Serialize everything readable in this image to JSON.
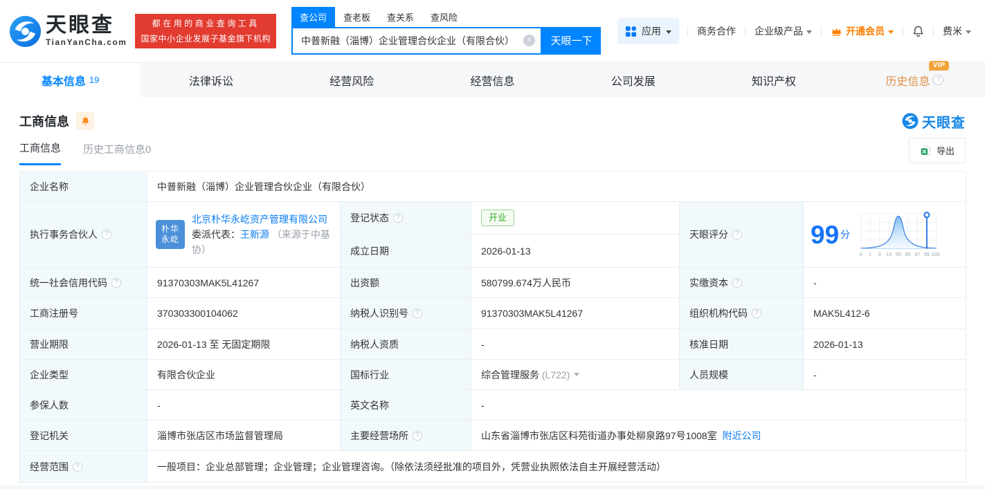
{
  "icons": {
    "help": "?",
    "clear": "×"
  },
  "header": {
    "brand": {
      "name": "天眼查",
      "domain": "TianYanCha.com"
    },
    "slogan_line1": "都在用的商业查询工具",
    "slogan_line2": "国家中小企业发展子基金旗下机构",
    "search": {
      "tabs": [
        {
          "label": "查公司"
        },
        {
          "label": "查老板"
        },
        {
          "label": "查关系"
        },
        {
          "label": "查风险"
        }
      ],
      "value": "中普新融（淄博）企业管理合伙企业（有限合伙）",
      "button": "天眼一下"
    },
    "nav": {
      "apps": "应用",
      "cooperation": "商务合作",
      "enterprise": "企业级产品",
      "membership": "开通会员",
      "username": "费米"
    }
  },
  "top_tabs": {
    "items": [
      {
        "label": "基本信息",
        "count": "19"
      },
      {
        "label": "法律诉讼"
      },
      {
        "label": "经营风险"
      },
      {
        "label": "经营信息"
      },
      {
        "label": "公司发展"
      },
      {
        "label": "知识产权"
      },
      {
        "label": "历史信息",
        "vip": "VIP"
      }
    ]
  },
  "section": {
    "title": "工商信息",
    "watermark": "天眼查"
  },
  "subtabs": {
    "current": "工商信息",
    "history": "历史工商信息0",
    "export": "导出"
  },
  "info": {
    "company_name": {
      "label": "企业名称",
      "value": "中普新融（淄博）企业管理合伙企业（有限合伙）"
    },
    "partner": {
      "label": "执行事务合伙人",
      "avatar_line1": "朴华",
      "avatar_line2": "永屹",
      "company": "北京朴华永屹资产管理有限公司",
      "delegate_label": "委派代表：",
      "delegate": "王新源",
      "delegate_note": "（来源于中基协）"
    },
    "reg_status": {
      "label": "登记状态",
      "value": "开业"
    },
    "establish_date": {
      "label": "成立日期",
      "value": "2026-01-13"
    },
    "score": {
      "label": "天眼评分"
    },
    "credit_code": {
      "label": "统一社会信用代码",
      "value": "91370303MAK5L41267"
    },
    "capital": {
      "label": "出资额",
      "value": "580799.674万人民币"
    },
    "paid_capital": {
      "label": "实缴资本",
      "value": "-"
    },
    "reg_number": {
      "label": "工商注册号",
      "value": "370303300104062"
    },
    "taxpayer_id": {
      "label": "纳税人识别号",
      "value": "91370303MAK5L41267"
    },
    "org_code": {
      "label": "组织机构代码",
      "value": "MAK5L412-6"
    },
    "business_term": {
      "label": "营业期限",
      "value": "2026-01-13 至 无固定期限"
    },
    "taxpayer_quality": {
      "label": "纳税人资质",
      "value": "-"
    },
    "approval_date": {
      "label": "核准日期",
      "value": "2026-01-13"
    },
    "company_type": {
      "label": "企业类型",
      "value": "有限合伙企业"
    },
    "industry": {
      "label": "国标行业",
      "value": "综合管理服务",
      "code": "(L722)"
    },
    "staff_size": {
      "label": "人员规模",
      "value": "-"
    },
    "insured_count": {
      "label": "参保人数",
      "value": "-"
    },
    "english_name": {
      "label": "英文名称",
      "value": "-"
    },
    "reg_authority": {
      "label": "登记机关",
      "value": "淄博市张店区市场监督管理局"
    },
    "business_address": {
      "label": "主要经营场所",
      "value": "山东省淄博市张店区科苑街道办事处柳泉路97号1008室",
      "link": "附近公司"
    },
    "business_scope": {
      "label": "经营范围",
      "value": "一般项目：企业总部管理；企业管理；企业管理咨询。（除依法须经批准的项目外，凭营业执照依法自主开展经营活动）"
    }
  },
  "chart_data": {
    "type": "area",
    "title": "天眼评分",
    "score": "99",
    "unit": "分",
    "curve": "bell-distribution",
    "ticks": [
      "0",
      "1",
      "3",
      "15",
      "50",
      "85",
      "97",
      "99",
      "100"
    ],
    "marker_value": "99",
    "accent": "#2f7ae5",
    "grid": true
  }
}
